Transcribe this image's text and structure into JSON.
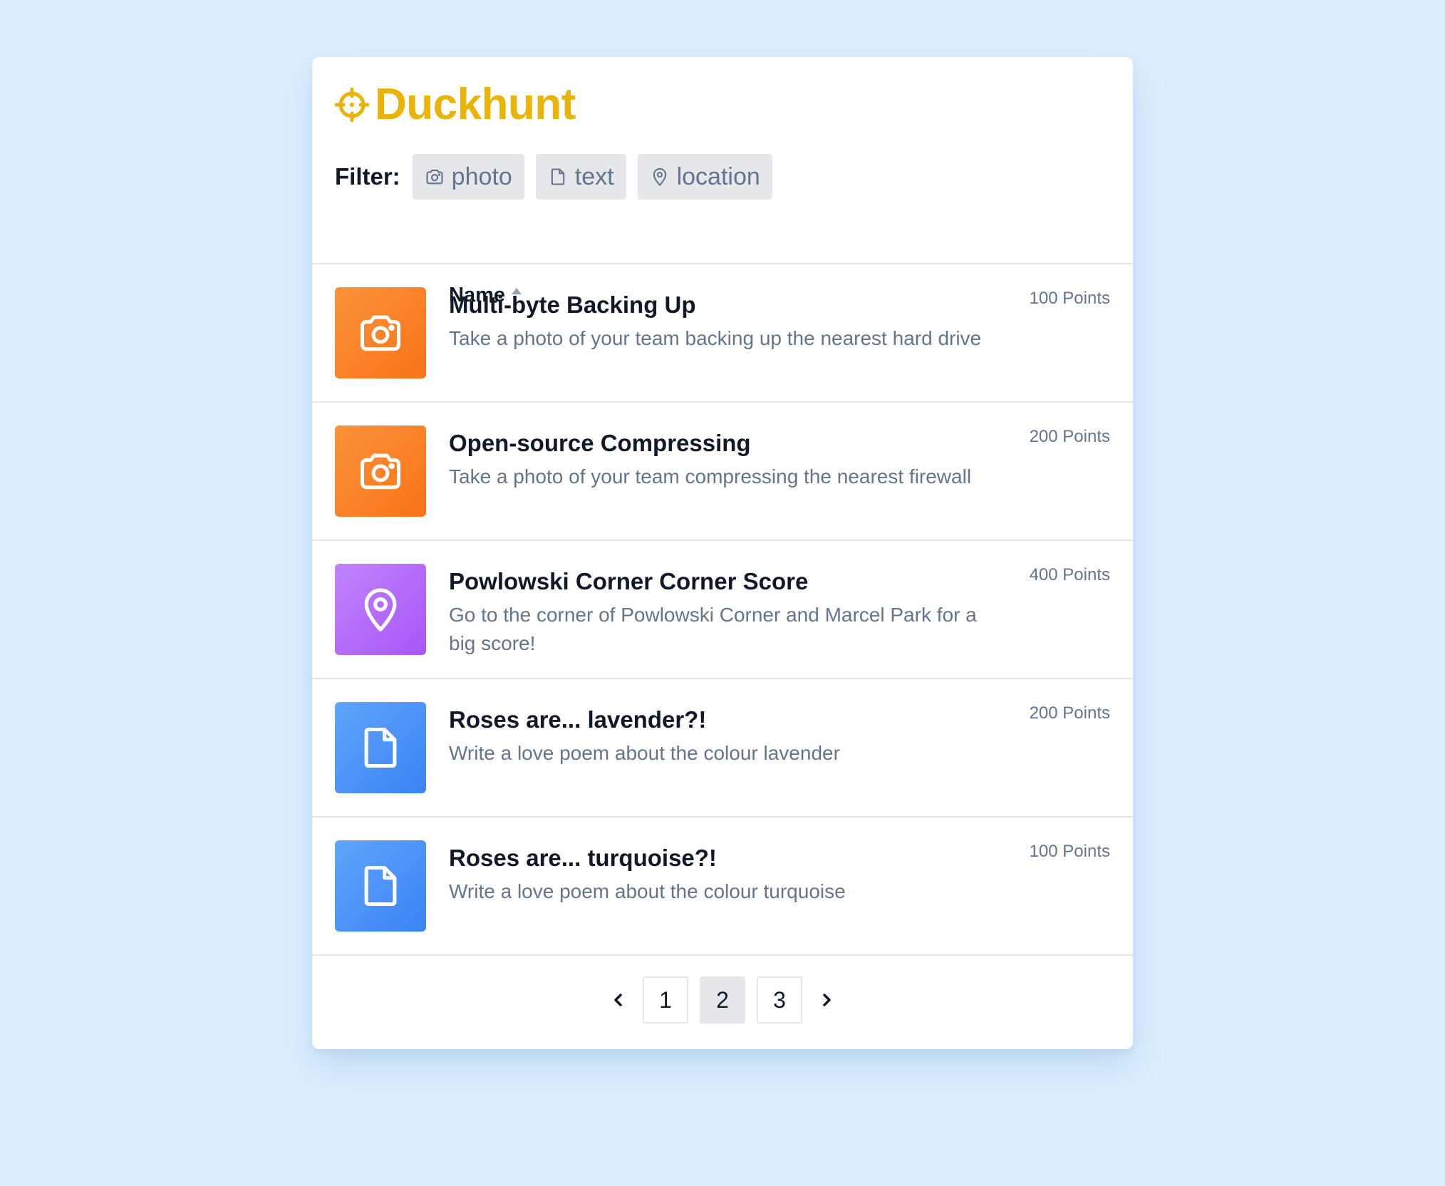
{
  "app": {
    "title": "Duckhunt",
    "brand_color": "#eab308"
  },
  "filter": {
    "label": "Filter:",
    "chips": [
      {
        "label": "photo",
        "icon": "camera-icon"
      },
      {
        "label": "text",
        "icon": "file-icon"
      },
      {
        "label": "location",
        "icon": "map-pin-icon"
      }
    ]
  },
  "table": {
    "column_header": "Name",
    "sort": "ascending",
    "rows": [
      {
        "type": "photo",
        "icon": "camera-icon",
        "color": "#f97316",
        "title": "Multi-byte Backing Up",
        "description": "Take a photo of your team backing up the nearest hard drive",
        "points": "100 Points"
      },
      {
        "type": "photo",
        "icon": "camera-icon",
        "color": "#f97316",
        "title": "Open-source Compressing",
        "description": "Take a photo of your team compressing the nearest firewall",
        "points": "200 Points"
      },
      {
        "type": "location",
        "icon": "map-pin-icon",
        "color": "#a855f7",
        "title": "Powlowski Corner Corner Score",
        "description": "Go to the corner of Powlowski Corner and Marcel Park for a big score!",
        "points": "400 Points"
      },
      {
        "type": "text",
        "icon": "file-icon",
        "color": "#3b82f6",
        "title": "Roses are... lavender?!",
        "description": "Write a love poem about the colour lavender",
        "points": "200 Points"
      },
      {
        "type": "text",
        "icon": "file-icon",
        "color": "#3b82f6",
        "title": "Roses are... turquoise?!",
        "description": "Write a love poem about the colour turquoise",
        "points": "100 Points"
      }
    ]
  },
  "pagination": {
    "pages": [
      "1",
      "2",
      "3"
    ],
    "current": "2"
  }
}
